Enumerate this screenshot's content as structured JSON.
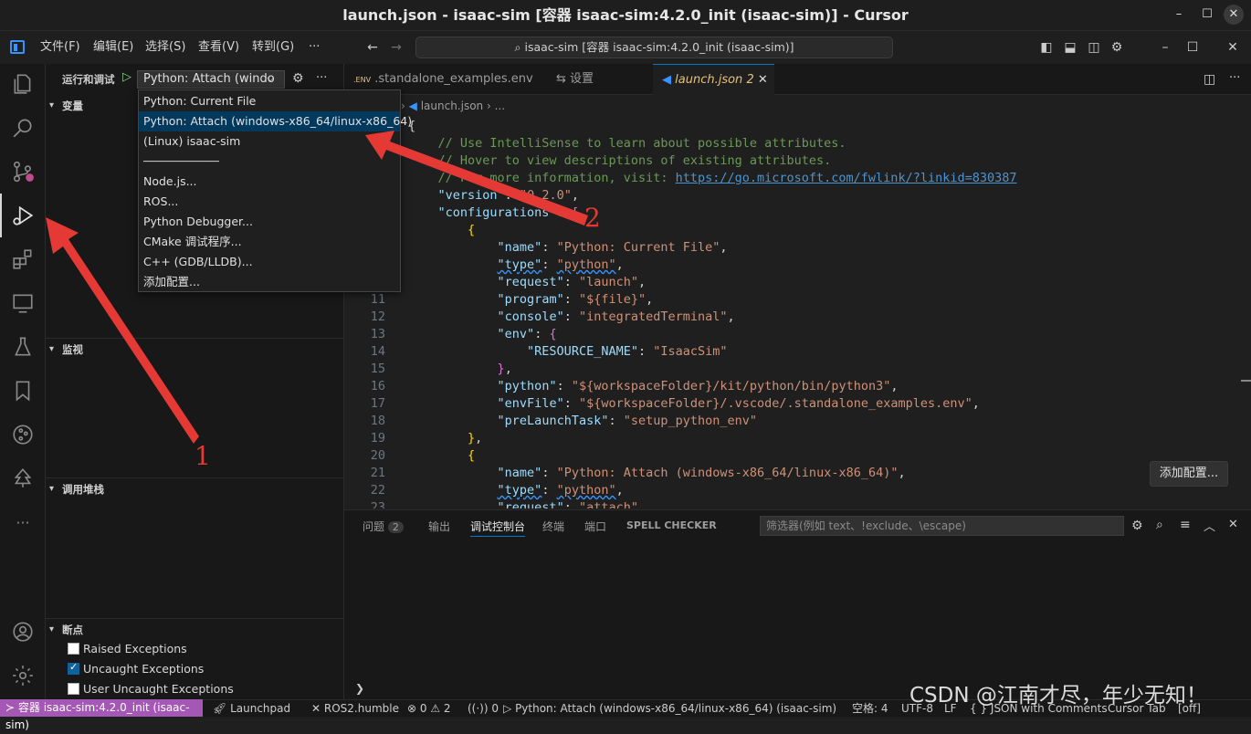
{
  "window": {
    "title": "launch.json - isaac-sim [容器 isaac-sim:4.2.0_init (isaac-sim)] - Cursor",
    "minimize": "–",
    "maximize": "☐",
    "close": "✕"
  },
  "menu": {
    "items": [
      "文件(F)",
      "编辑(E)",
      "选择(S)",
      "查看(V)",
      "转到(G)",
      "···"
    ],
    "command_center": "isaac-sim [容器 isaac-sim:4.2.0_init (isaac-sim)]"
  },
  "sidebar": {
    "header": "运行和调试",
    "config_select": "Python: Attach (windo",
    "more": "···",
    "sections": {
      "variables": "变量",
      "watch": "监视",
      "callstack": "调用堆栈",
      "breakpoints": "断点"
    },
    "breakpoints": [
      {
        "label": "Raised Exceptions",
        "checked": false
      },
      {
        "label": "Uncaught Exceptions",
        "checked": true
      },
      {
        "label": "User Uncaught Exceptions",
        "checked": false
      }
    ]
  },
  "dropdown": {
    "items": [
      "Python: Current File",
      "Python: Attach (windows-x86_64/linux-x86_64)",
      "(Linux) isaac-sim",
      "───────────",
      "Node.js...",
      "ROS...",
      "Python Debugger...",
      "CMake 调试程序...",
      "C++ (GDB/LLDB)...",
      "添加配置..."
    ],
    "selected_index": 1
  },
  "tabs": [
    {
      "icon_text": ".ENV",
      "label": ".standalone_examples.env"
    },
    {
      "icon_text": "⇆",
      "label": "设置"
    },
    {
      "label": "launch.json",
      "badge": "2",
      "active": true
    }
  ],
  "breadcrumb": {
    "file": "launch.json",
    "more": "..."
  },
  "editor": {
    "lines": [
      {
        "n": "",
        "html": "<span class='pun'>{</span>"
      },
      {
        "n": "",
        "html": "    <span class='cm'>// Use IntelliSense to learn about possible attributes.</span>"
      },
      {
        "n": "",
        "html": "    <span class='cm'>// Hover to view descriptions of existing attributes.</span>"
      },
      {
        "n": "",
        "html": "    <span class='cm'>// For more information, visit: <span class='lnk'>https://go.microsoft.com/fwlink/?linkid=830387</span></span>"
      },
      {
        "n": "",
        "html": "    <span class='key'>\"version\"</span><span class='pun'>: </span><span class='str'>\"0.2.0\"</span><span class='pun'>,</span>"
      },
      {
        "n": "",
        "html": "    <span class='key'>\"configurations\"</span><span class='pun'>: </span><span class='brk2'>[</span>"
      },
      {
        "n": "",
        "html": "        <span class='brk'>{</span>"
      },
      {
        "n": "",
        "html": "            <span class='key'>\"name\"</span><span class='pun'>: </span><span class='str'>\"Python: Current File\"</span><span class='pun'>,</span>"
      },
      {
        "n": "",
        "html": "            <span class='key squig'>\"type\"</span><span class='pun'>: </span><span class='str squig'>\"python\"</span><span class='pun'>,</span>"
      },
      {
        "n": "",
        "html": "            <span class='key'>\"request\"</span><span class='pun'>: </span><span class='str'>\"launch\"</span><span class='pun'>,</span>"
      },
      {
        "n": "11",
        "html": "            <span class='key'>\"program\"</span><span class='pun'>: </span><span class='str'>\"${file}\"</span><span class='pun'>,</span>"
      },
      {
        "n": "12",
        "html": "            <span class='key'>\"console\"</span><span class='pun'>: </span><span class='str'>\"integratedTerminal\"</span><span class='pun'>,</span>"
      },
      {
        "n": "13",
        "html": "            <span class='key'>\"env\"</span><span class='pun'>: </span><span class='brk2'>{</span>"
      },
      {
        "n": "14",
        "html": "                <span class='key'>\"RESOURCE_NAME\"</span><span class='pun'>: </span><span class='str'>\"IsaacSim\"</span>"
      },
      {
        "n": "15",
        "html": "            <span class='brk2'>}</span><span class='pun'>,</span>"
      },
      {
        "n": "16",
        "html": "            <span class='key'>\"python\"</span><span class='pun'>: </span><span class='str'>\"${workspaceFolder}/kit/python/bin/python3\"</span><span class='pun'>,</span>"
      },
      {
        "n": "17",
        "html": "            <span class='key'>\"envFile\"</span><span class='pun'>: </span><span class='str'>\"${workspaceFolder}/.vscode/.standalone_examples.env\"</span><span class='pun'>,</span>"
      },
      {
        "n": "18",
        "html": "            <span class='key'>\"preLaunchTask\"</span><span class='pun'>: </span><span class='str'>\"setup_python_env\"</span>"
      },
      {
        "n": "19",
        "html": "        <span class='brk'>}</span><span class='pun'>,</span>"
      },
      {
        "n": "20",
        "html": "        <span class='brk'>{</span>"
      },
      {
        "n": "21",
        "html": "            <span class='key'>\"name\"</span><span class='pun'>: </span><span class='str'>\"Python: Attach (windows-x86_64/linux-x86_64)\"</span><span class='pun'>,</span>"
      },
      {
        "n": "22",
        "html": "            <span class='key squig'>\"type\"</span><span class='pun'>: </span><span class='str squig'>\"python\"</span><span class='pun'>,</span>"
      },
      {
        "n": "23",
        "html": "            <span class='key'>\"request\"</span><span class='pun'>: </span><span class='str'>\"attach\"</span><span class='pun'>,</span>"
      }
    ],
    "add_config_button": "添加配置..."
  },
  "panel": {
    "tabs": [
      {
        "label": "问题",
        "badge": "2"
      },
      {
        "label": "输出"
      },
      {
        "label": "调试控制台",
        "active": true
      },
      {
        "label": "终端"
      },
      {
        "label": "端口"
      },
      {
        "label": "SPELL CHECKER"
      }
    ],
    "filter_placeholder": "筛选器(例如 text、!exclude、\\escape)",
    "prompt": "❯"
  },
  "statusbar": {
    "remote": "容器 isaac-sim:4.2.0_init (isaac-sim)",
    "items_left": [
      "Launchpad",
      "ROS2.humble",
      "⊗ 0 ⚠ 2",
      "0",
      "Python: Attach (windows-x86_64/linux-x86_64) (isaac-sim)"
    ],
    "items_right": [
      "空格: 4",
      "UTF-8",
      "LF",
      "{ } JSON with Comments",
      "Cursor Tab",
      "[off]"
    ]
  },
  "annotations": {
    "label_1": "1",
    "label_2": "2",
    "arrow_color": "#e53935"
  },
  "watermark": "CSDN @江南才尽，年少无知！",
  "colors": {
    "accent": "#0078d4",
    "remote": "#a557b5",
    "selection": "#04395e"
  }
}
